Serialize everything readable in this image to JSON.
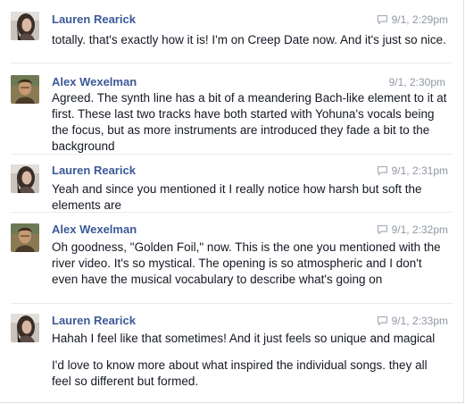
{
  "messages": [
    {
      "sender": "Lauren Rearick",
      "avatar": "lauren-avatar",
      "timestamp": "9/1, 2:29pm",
      "paragraphs": [
        "totally. that's exactly how it is! I'm on Creep Date now. And it's just so nice."
      ]
    },
    {
      "sender": "Alex Wexelman",
      "avatar": "alex-avatar",
      "timestamp": "9/1, 2:30pm",
      "paragraphs": [
        "Agreed. The synth line has a bit of a meandering Bach-like element to it at first. These last two tracks have both started with Yohuna's vocals being the focus, but as more instruments are introduced they fade a bit to the background"
      ]
    },
    {
      "sender": "Lauren Rearick",
      "avatar": "lauren-avatar",
      "timestamp": "9/1, 2:31pm",
      "paragraphs": [
        "Yeah and since you mentioned it I really notice how harsh but soft the elements are"
      ]
    },
    {
      "sender": "Alex Wexelman",
      "avatar": "alex-avatar",
      "timestamp": "9/1, 2:32pm",
      "paragraphs": [
        "Oh goodness, \"Golden Foil,\" now. This is the one you mentioned with the river video. It's so mystical. The opening is so atmospheric and I don't even have the musical vocabulary to describe what's going on"
      ]
    },
    {
      "sender": "Lauren Rearick",
      "avatar": "lauren-avatar",
      "timestamp": "9/1, 2:33pm",
      "paragraphs": [
        "Hahah I feel like that sometimes! And it just feels so unique and magical",
        "I'd love to know more about what inspired the individual songs. they all feel so different but formed."
      ]
    }
  ],
  "colors": {
    "name": "#3b5998",
    "text": "#141823",
    "meta": "#9197a3",
    "divider": "#e9ebee"
  },
  "icons": {
    "message-status": "speech-bubble-icon"
  }
}
